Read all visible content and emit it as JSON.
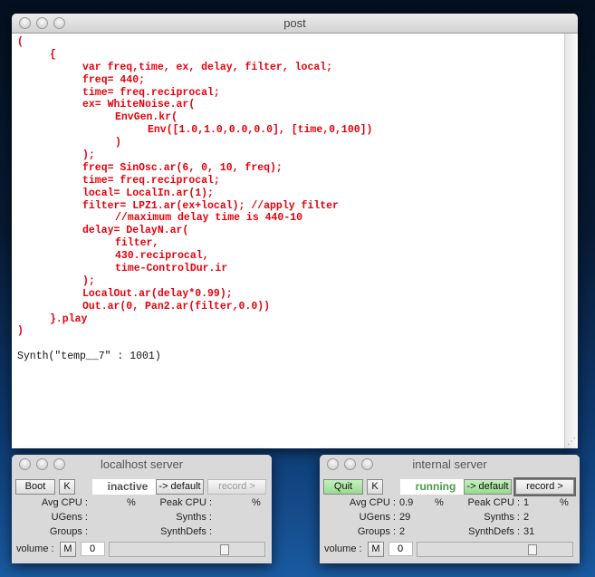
{
  "post": {
    "title": "post",
    "lines": [
      {
        "i": 0,
        "t": "(",
        "k": "code"
      },
      {
        "i": 1,
        "t": "{",
        "k": "code"
      },
      {
        "i": 2,
        "t": "var freq,time, ex, delay, filter, local;",
        "k": "code"
      },
      {
        "i": 2,
        "t": "freq= 440;",
        "k": "code"
      },
      {
        "i": 2,
        "t": "time= freq.reciprocal;",
        "k": "code"
      },
      {
        "i": 2,
        "t": "ex= WhiteNoise.ar(",
        "k": "code"
      },
      {
        "i": 3,
        "t": "EnvGen.kr(",
        "k": "code"
      },
      {
        "i": 4,
        "t": "Env([1.0,1.0,0.0,0.0], [time,0,100])",
        "k": "code"
      },
      {
        "i": 3,
        "t": ")",
        "k": "code"
      },
      {
        "i": 2,
        "t": ");",
        "k": "code"
      },
      {
        "i": 2,
        "t": "freq= SinOsc.ar(6, 0, 10, freq);",
        "k": "code"
      },
      {
        "i": 2,
        "t": "time= freq.reciprocal;",
        "k": "code"
      },
      {
        "i": 2,
        "t": "local= LocalIn.ar(1);",
        "k": "code"
      },
      {
        "i": 2,
        "t": "filter= LPZ1.ar(ex+local); //apply filter",
        "k": "code"
      },
      {
        "i": 3,
        "t": "//maximum delay time is 440-10",
        "k": "code"
      },
      {
        "i": 2,
        "t": "delay= DelayN.ar(",
        "k": "code"
      },
      {
        "i": 3,
        "t": "filter,",
        "k": "code"
      },
      {
        "i": 3,
        "t": "430.reciprocal,",
        "k": "code"
      },
      {
        "i": 3,
        "t": "time-ControlDur.ir",
        "k": "code"
      },
      {
        "i": 2,
        "t": ");",
        "k": "code"
      },
      {
        "i": 2,
        "t": "LocalOut.ar(delay*0.99);",
        "k": "code"
      },
      {
        "i": 2,
        "t": "Out.ar(0, Pan2.ar(filter,0.0))",
        "k": "code"
      },
      {
        "i": 1,
        "t": "}.play",
        "k": "code"
      },
      {
        "i": 0,
        "t": ")",
        "k": "code"
      },
      {
        "i": 0,
        "t": "",
        "k": "out"
      },
      {
        "i": 0,
        "t": "Synth(\"temp__7\" : 1001)",
        "k": "out"
      }
    ]
  },
  "localhost": {
    "title": "localhost server",
    "boot": "Boot",
    "k": "K",
    "status": "inactive",
    "default": "-> default",
    "record": "record >",
    "avg_cpu_label": "Avg CPU :",
    "avg_cpu": "",
    "pct": "%",
    "peak_cpu_label": "Peak CPU :",
    "peak_cpu": "",
    "ugens_label": "UGens :",
    "ugens": "",
    "synths_label": "Synths :",
    "synths": "",
    "groups_label": "Groups :",
    "groups": "",
    "synthdefs_label": "SynthDefs :",
    "synthdefs": "",
    "volume_label": "volume :",
    "mute": "M",
    "volume": "0",
    "volume_slider": 0.77
  },
  "internal": {
    "title": "internal server",
    "boot": "Quit",
    "k": "K",
    "status": "running",
    "default": "-> default",
    "record": "record >",
    "avg_cpu_label": "Avg CPU :",
    "avg_cpu": "0.9",
    "pct": "%",
    "peak_cpu_label": "Peak CPU :",
    "peak_cpu": "1",
    "ugens_label": "UGens :",
    "ugens": "29",
    "synths_label": "Synths :",
    "synths": "2",
    "groups_label": "Groups :",
    "groups": "2",
    "synthdefs_label": "SynthDefs :",
    "synthdefs": "31",
    "volume_label": "volume :",
    "mute": "M",
    "volume": "0",
    "volume_slider": 0.77
  },
  "colors": {
    "code": "#e8000b",
    "running": "#4a9a4a",
    "green_button": "#a8e0a0"
  }
}
